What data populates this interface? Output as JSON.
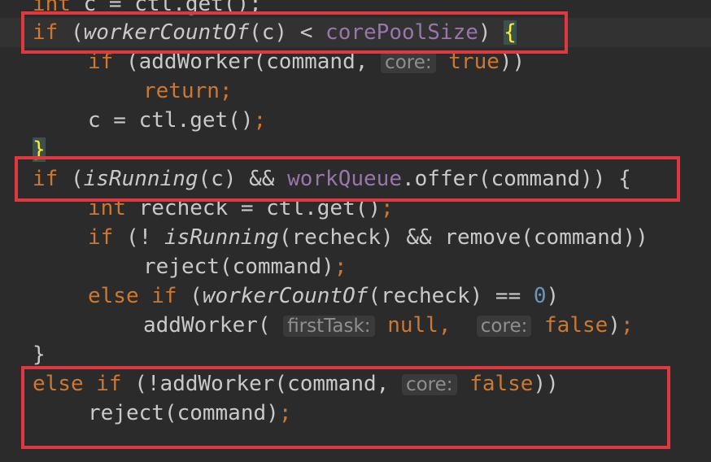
{
  "colors": {
    "background": "#2b2b2b",
    "keyword": "#cc7832",
    "field": "#9876aa",
    "number": "#6897bb",
    "hint": "#8f8f8f",
    "highlight_box": "#e0383f"
  },
  "code": {
    "l0": {
      "t1": "int",
      "t2": " c = ctl.get();"
    },
    "l1": {
      "k": "if",
      "p1": " (",
      "f": "workerCountOf",
      "p2": "(c) < ",
      "fld": "corePoolSize",
      "p3": ") ",
      "b": "{"
    },
    "l2": {
      "k": "if",
      "p1": " (addWorker(command, ",
      "h": "core:",
      "v": "true",
      "p2": "))"
    },
    "l3": {
      "k": "return",
      "s": ";"
    },
    "l4": {
      "p1": "c = ctl.get()",
      "s": ";"
    },
    "l5": {
      "b": "}"
    },
    "l6": {
      "k": "if",
      "p1": " (",
      "f": "isRunning",
      "p2": "(c) && ",
      "fld": "workQueue",
      "p3": ".offer(command)) ",
      "b": "{"
    },
    "l7": {
      "k": "int",
      "p1": " recheck = ctl.get()",
      "s": ";"
    },
    "l8": {
      "k": "if",
      "p1": " (! ",
      "f": "isRunning",
      "p2": "(recheck) && remove(command))"
    },
    "l9": {
      "p1": "reject(command)",
      "s": ";"
    },
    "l10": {
      "k": "else if",
      "p1": " (",
      "f": "workerCountOf",
      "p2": "(recheck) == ",
      "n": "0",
      "p3": ")"
    },
    "l11": {
      "p1": "addWorker( ",
      "h1": "firstTask:",
      "v1": "null",
      "c": ",  ",
      "h2": "core:",
      "v2": "false",
      "p2": ")",
      "s": ";"
    },
    "l12": {
      "p1": "}"
    },
    "l13": {
      "k": "else if",
      "p1": " (!addWorker(command, ",
      "h": "core:",
      "v": "false",
      "p2": "))"
    },
    "l14": {
      "p1": "reject(command)",
      "s": ";"
    }
  }
}
